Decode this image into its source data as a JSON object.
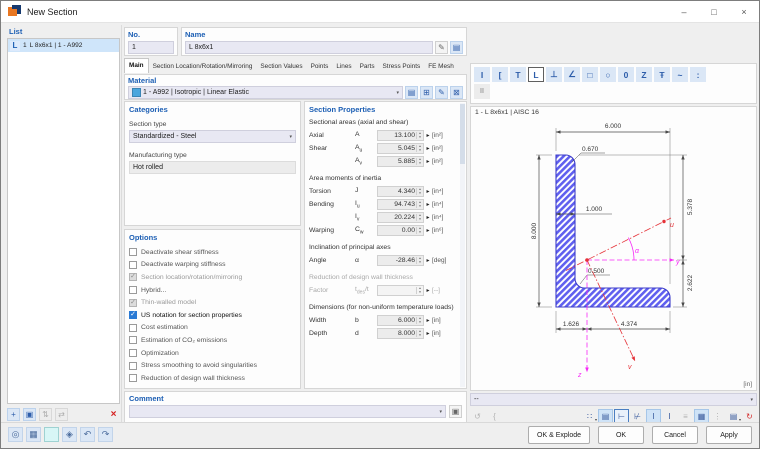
{
  "window": {
    "title": "New Section"
  },
  "titlebar_controls": {
    "minimize": "–",
    "maximize": "□",
    "close": "×"
  },
  "glyphs": {
    "spin_up": "▴",
    "spin_down": "▾",
    "detail": "▸",
    "caret": "▾",
    "check": "✓"
  },
  "list_panel": {
    "header": "List",
    "item": {
      "icon": "L",
      "no": "1",
      "label": "L 8x6x1 | 1 - A992"
    },
    "toolbar": [
      {
        "name": "new-section",
        "glyph": "+"
      },
      {
        "name": "copy-section",
        "glyph": "▣"
      },
      {
        "name": "select-check",
        "glyph": "⇅"
      },
      {
        "name": "renumber",
        "glyph": "⇄"
      },
      {
        "name": "delete-section",
        "glyph": "×"
      }
    ]
  },
  "no_field": {
    "label": "No.",
    "value": "1"
  },
  "name_field": {
    "label": "Name",
    "value": "L 8x6x1"
  },
  "name_buttons": [
    {
      "name": "rename",
      "glyph": "✎"
    },
    {
      "name": "section-library",
      "glyph": "▤"
    }
  ],
  "tabs": [
    "Main",
    "Section Location/Rotation/Mirroring",
    "Section Values",
    "Points",
    "Lines",
    "Parts",
    "Stress Points",
    "FE Mesh"
  ],
  "material": {
    "header": "Material",
    "value": "1 - A992 | Isotropic | Linear Elastic",
    "swatch_color": "#4ba6dd",
    "buttons": [
      {
        "name": "material-library",
        "glyph": "▤"
      },
      {
        "name": "material-new",
        "glyph": "⊞"
      },
      {
        "name": "material-edit",
        "glyph": "✎"
      },
      {
        "name": "material-delete",
        "glyph": "⊠"
      }
    ]
  },
  "shape_bar": {
    "icons": [
      "I",
      "[",
      "T",
      "L",
      "⊥",
      "∠",
      "□",
      "○",
      "0",
      "Z",
      "Ŧ",
      "~",
      ":"
    ],
    "row2": "II"
  },
  "categories": {
    "header": "Categories",
    "section_type_label": "Section type",
    "section_type_value": "Standardized - Steel",
    "manufacturing_label": "Manufacturing type",
    "manufacturing_value": "Hot rolled"
  },
  "options": {
    "header": "Options",
    "items": [
      {
        "label": "Deactivate shear stiffness",
        "checked": false,
        "enabled": true
      },
      {
        "label": "Deactivate warping stiffness",
        "checked": false,
        "enabled": true
      },
      {
        "label": "Section location/rotation/mirroring",
        "checked": true,
        "enabled": false
      },
      {
        "label": "Hybrid...",
        "checked": false,
        "enabled": true
      },
      {
        "label": "Thin-walled model",
        "checked": true,
        "enabled": false
      },
      {
        "label": "US notation for section properties",
        "checked": true,
        "enabled": true
      },
      {
        "label": "Cost estimation",
        "checked": false,
        "enabled": true
      },
      {
        "label": "Estimation of CO₂ emissions",
        "checked": false,
        "enabled": true
      },
      {
        "label": "Optimization",
        "checked": false,
        "enabled": true
      },
      {
        "label": "Stress smoothing to avoid singularities",
        "checked": false,
        "enabled": true
      },
      {
        "label": "Reduction of design wall thickness",
        "checked": false,
        "enabled": true
      }
    ]
  },
  "props": {
    "header": "Section Properties",
    "subs": [
      "Sectional areas (axial and shear)",
      "Area moments of inertia",
      "Inclination of principal axes",
      "Reduction of design wall thickness",
      "Dimensions (for non-uniform temperature loads)"
    ],
    "rows": [
      {
        "label": "Axial",
        "sym": "A",
        "sub": "",
        "tail": "",
        "value": "13.100",
        "unit": "[in²]"
      },
      {
        "label": "Shear",
        "sym": "A",
        "sub": "u",
        "tail": "",
        "value": "5.045",
        "unit": "[in²]"
      },
      {
        "label": "",
        "sym": "A",
        "sub": "v",
        "tail": "",
        "value": "5.885",
        "unit": "[in²]"
      },
      {
        "label": "Torsion",
        "sym": "J",
        "sub": "",
        "tail": "",
        "value": "4.340",
        "unit": "[in⁴]"
      },
      {
        "label": "Bending",
        "sym": "I",
        "sub": "u",
        "tail": "",
        "value": "94.743",
        "unit": "[in⁴]"
      },
      {
        "label": "",
        "sym": "I",
        "sub": "v",
        "tail": "",
        "value": "20.224",
        "unit": "[in⁴]"
      },
      {
        "label": "Warping",
        "sym": "C",
        "sub": "w",
        "tail": "",
        "value": "0.00",
        "unit": "[in⁶]"
      },
      {
        "label": "Angle",
        "sym": "α",
        "sub": "",
        "tail": "",
        "value": "-28.46",
        "unit": "[deg]"
      },
      {
        "label": "Factor",
        "sym": "t",
        "sub": "des",
        "tail": "/t",
        "value": "",
        "unit": "[--]"
      },
      {
        "label": "Width",
        "sym": "b",
        "sub": "",
        "tail": "",
        "value": "6.000",
        "unit": "[in]"
      },
      {
        "label": "Depth",
        "sym": "d",
        "sub": "",
        "tail": "",
        "value": "8.000",
        "unit": "[in]"
      }
    ]
  },
  "drawing": {
    "title": "1 - L 8x6x1 | AISC 16",
    "unit": "[in]",
    "dims": {
      "width": "6.000",
      "height": "8.000",
      "thickness": "1.000",
      "toe_radius": "0.670",
      "fillet_radius": "0.500",
      "centroid_top": "5.378",
      "centroid_bottom": "2.622",
      "centroid_left": "1.626",
      "centroid_right": "4.374"
    },
    "axis_labels": {
      "y": "y",
      "z": "z",
      "u": "u",
      "v": "v",
      "alpha": "α"
    },
    "colors": {
      "section_fill": "#5f5fef",
      "section_outline": "#3d3dc9",
      "centroidal_axes": "#f728f7",
      "principal_axes": "#e53238",
      "dimensions": "#4a4a4a"
    }
  },
  "view_combo": {
    "value": "--"
  },
  "drawing_toolbar": {
    "left": [
      {
        "name": "rotate-section",
        "glyph": "↺"
      },
      {
        "name": "section-brackets",
        "glyph": "{"
      }
    ],
    "right": [
      {
        "name": "points-display",
        "glyph": "∷"
      },
      {
        "name": "graphic-window",
        "glyph": "▤"
      },
      {
        "name": "dimensions-display",
        "glyph": "⊢"
      },
      {
        "name": "stress-points-display",
        "glyph": "⊬"
      },
      {
        "name": "main-dimensions",
        "glyph": "Ι"
      },
      {
        "name": "aux-dimensions",
        "glyph": "Ι"
      },
      {
        "name": "welds-display",
        "glyph": "≡"
      },
      {
        "name": "grid-display",
        "glyph": "▦"
      },
      {
        "name": "values-display",
        "glyph": "⋮"
      },
      {
        "name": "print-graphic",
        "glyph": "▤"
      },
      {
        "name": "zoom-reset",
        "glyph": "↻"
      }
    ]
  },
  "comment": {
    "header": "Comment",
    "value": "",
    "copy_glyph": "▣"
  },
  "window_toolbar": [
    {
      "name": "find-section",
      "glyph": "◎"
    },
    {
      "name": "render-view",
      "glyph": "▦"
    },
    {
      "name": "color-box",
      "glyph": ""
    },
    {
      "name": "pick-window",
      "glyph": "◈"
    },
    {
      "name": "undo-view",
      "glyph": "↶"
    },
    {
      "name": "redo-view",
      "glyph": "↷"
    }
  ],
  "buttons": [
    "OK & Explode",
    "OK",
    "Cancel",
    "Apply"
  ]
}
